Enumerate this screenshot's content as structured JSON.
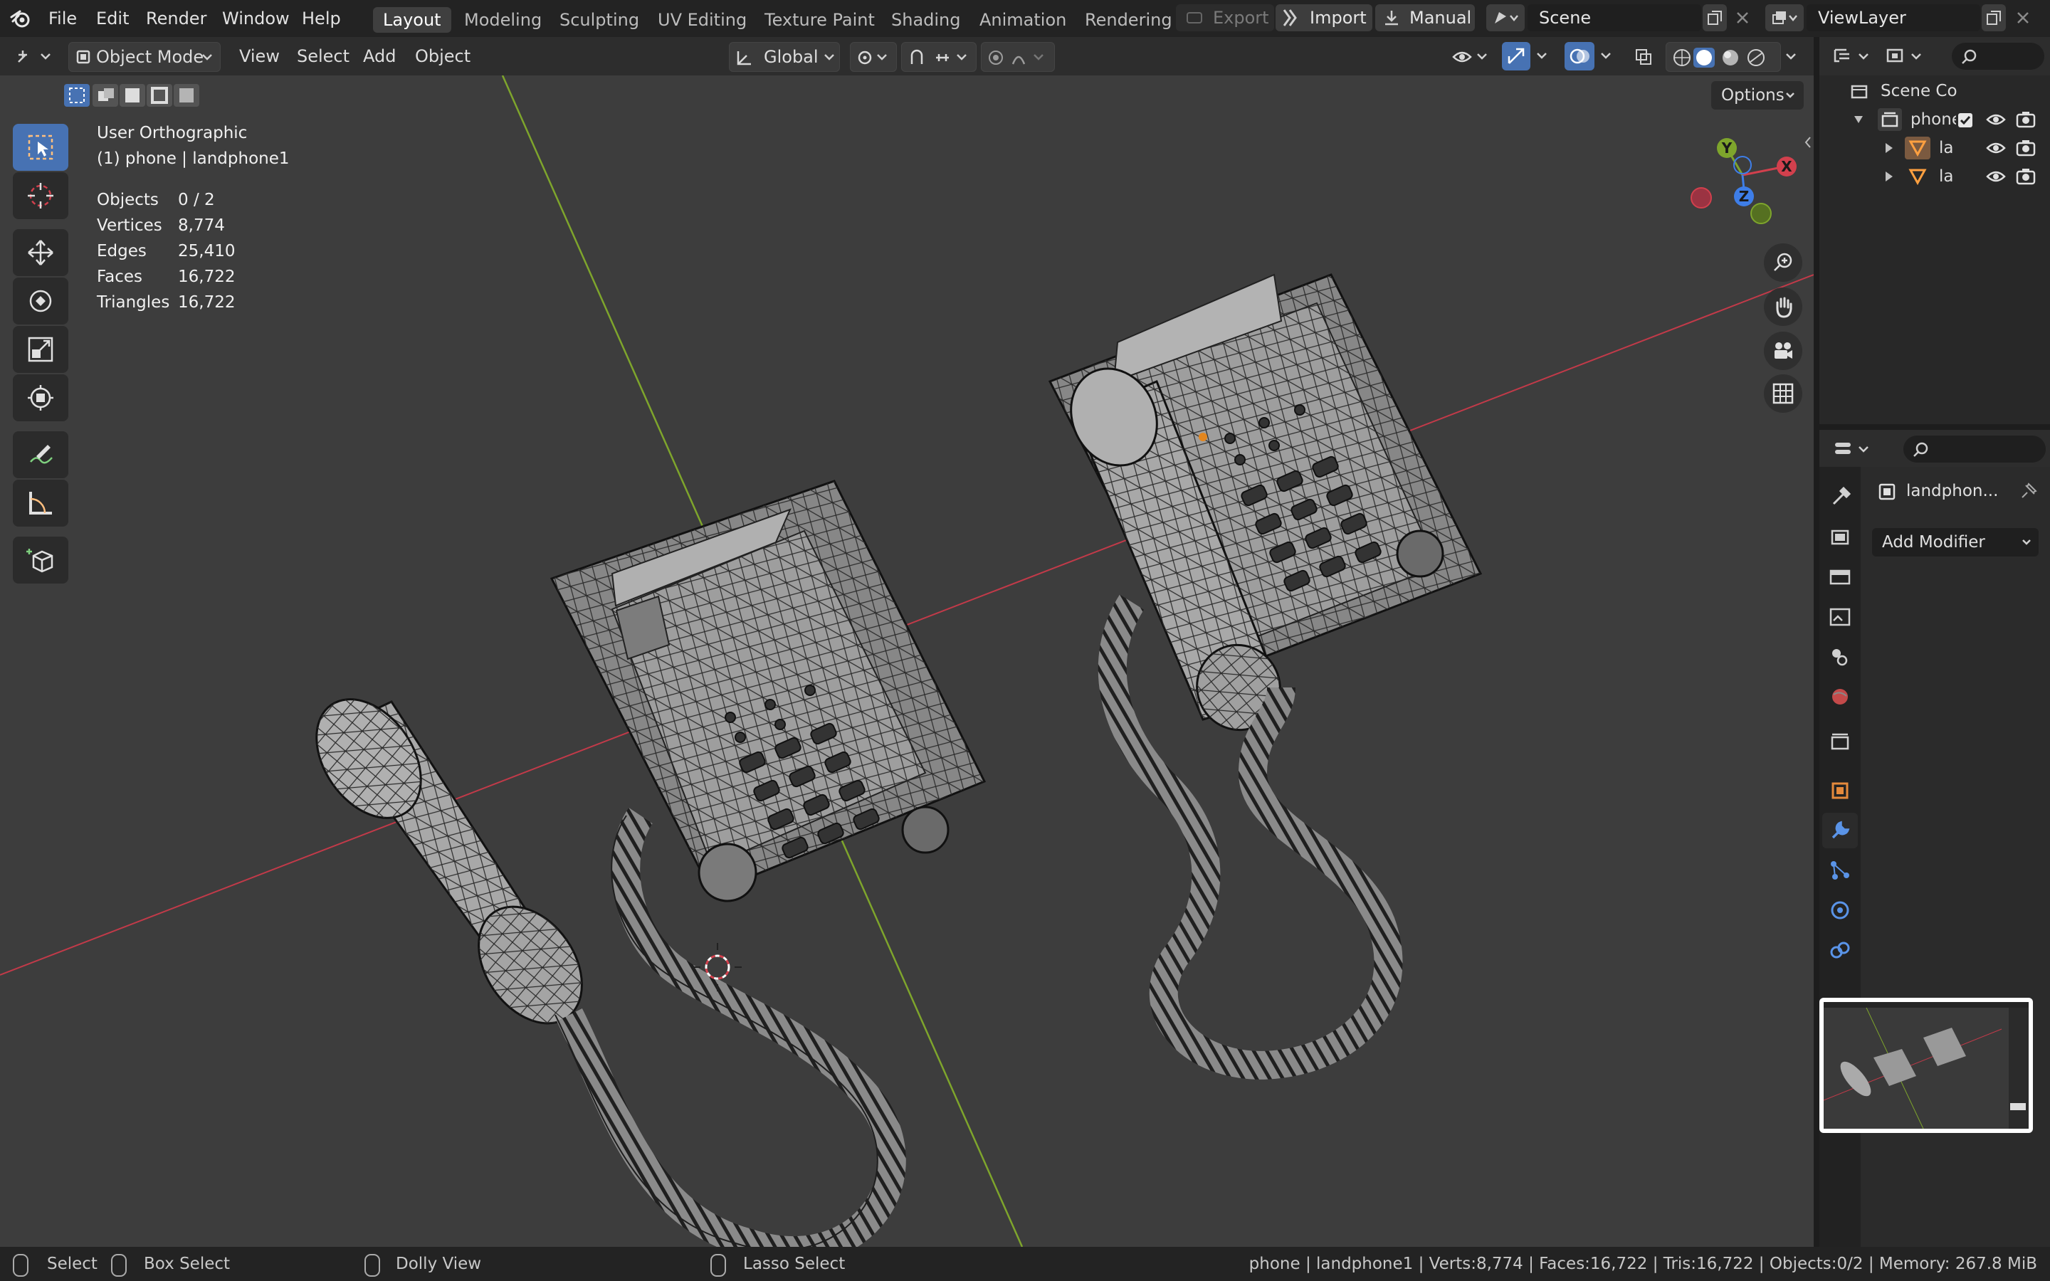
{
  "colors": {
    "accent": "#4772b3",
    "axis_x": "#d2404d",
    "axis_y": "#7ea52c",
    "axis_z": "#3e7ee8",
    "viewport_bg": "#3d3d3d"
  },
  "topbar": {
    "logo": "blender-logo-icon",
    "menus": [
      "File",
      "Edit",
      "Render",
      "Window",
      "Help"
    ],
    "workspaces": [
      "Layout",
      "Modeling",
      "Sculpting",
      "UV Editing",
      "Texture Paint",
      "Shading",
      "Animation",
      "Rendering"
    ],
    "active_workspace": "Layout",
    "export_label": "Export",
    "import_label": "Import",
    "manual_label": "Manual",
    "scene_value": "Scene",
    "viewlayer_value": "ViewLayer"
  },
  "viewport_header": {
    "mode_label": "Object Mode",
    "menus": [
      "View",
      "Select",
      "Add",
      "Object"
    ],
    "transform_orientation": "Global",
    "options_label": "Options"
  },
  "overlay": {
    "view_name": "User Orthographic",
    "object_info": "(1) phone | landphone1",
    "stats": [
      {
        "label": "Objects",
        "value": "0 / 2"
      },
      {
        "label": "Vertices",
        "value": "8,774"
      },
      {
        "label": "Edges",
        "value": "25,410"
      },
      {
        "label": "Faces",
        "value": "16,722"
      },
      {
        "label": "Triangles",
        "value": "16,722"
      }
    ]
  },
  "gizmo": {
    "x": "X",
    "y": "Y",
    "z": "Z"
  },
  "outliner": {
    "rows": [
      {
        "label": "Scene Co",
        "icon": "scene-collection-icon"
      },
      {
        "label": "phone",
        "icon": "collection-icon"
      },
      {
        "label": "la",
        "icon": "mesh-icon"
      },
      {
        "label": "la",
        "icon": "mesh-icon"
      }
    ]
  },
  "properties": {
    "object_name": "landphon...",
    "add_modifier_label": "Add Modifier",
    "tabs": [
      "tool-icon",
      "render-icon",
      "output-icon",
      "view-layer-icon",
      "scene-icon",
      "world-icon",
      "collection-icon",
      "object-icon",
      "modifier-icon",
      "particles-icon",
      "physics-icon",
      "constraints-icon"
    ]
  },
  "statusbar": {
    "select": "Select",
    "box_select": "Box Select",
    "dolly_view": "Dolly View",
    "lasso_select": "Lasso Select",
    "info": "phone | landphone1 | Verts:8,774 | Faces:16,722 | Tris:16,722 | Objects:0/2 | Memory: 267.8 MiB"
  }
}
